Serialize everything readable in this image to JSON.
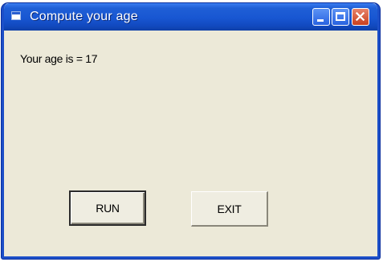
{
  "window": {
    "title": "Compute your age"
  },
  "titlebar_buttons": {
    "minimize_icon": "minimize-icon",
    "maximize_icon": "maximize-icon",
    "close_icon": "close-icon"
  },
  "form": {
    "result_text": "Your age is = 17",
    "run_label": "RUN",
    "exit_label": "EXIT"
  },
  "colors": {
    "titlebar": "#1856d2",
    "window_face": "#ece9d8",
    "close_button": "#c9401e"
  }
}
